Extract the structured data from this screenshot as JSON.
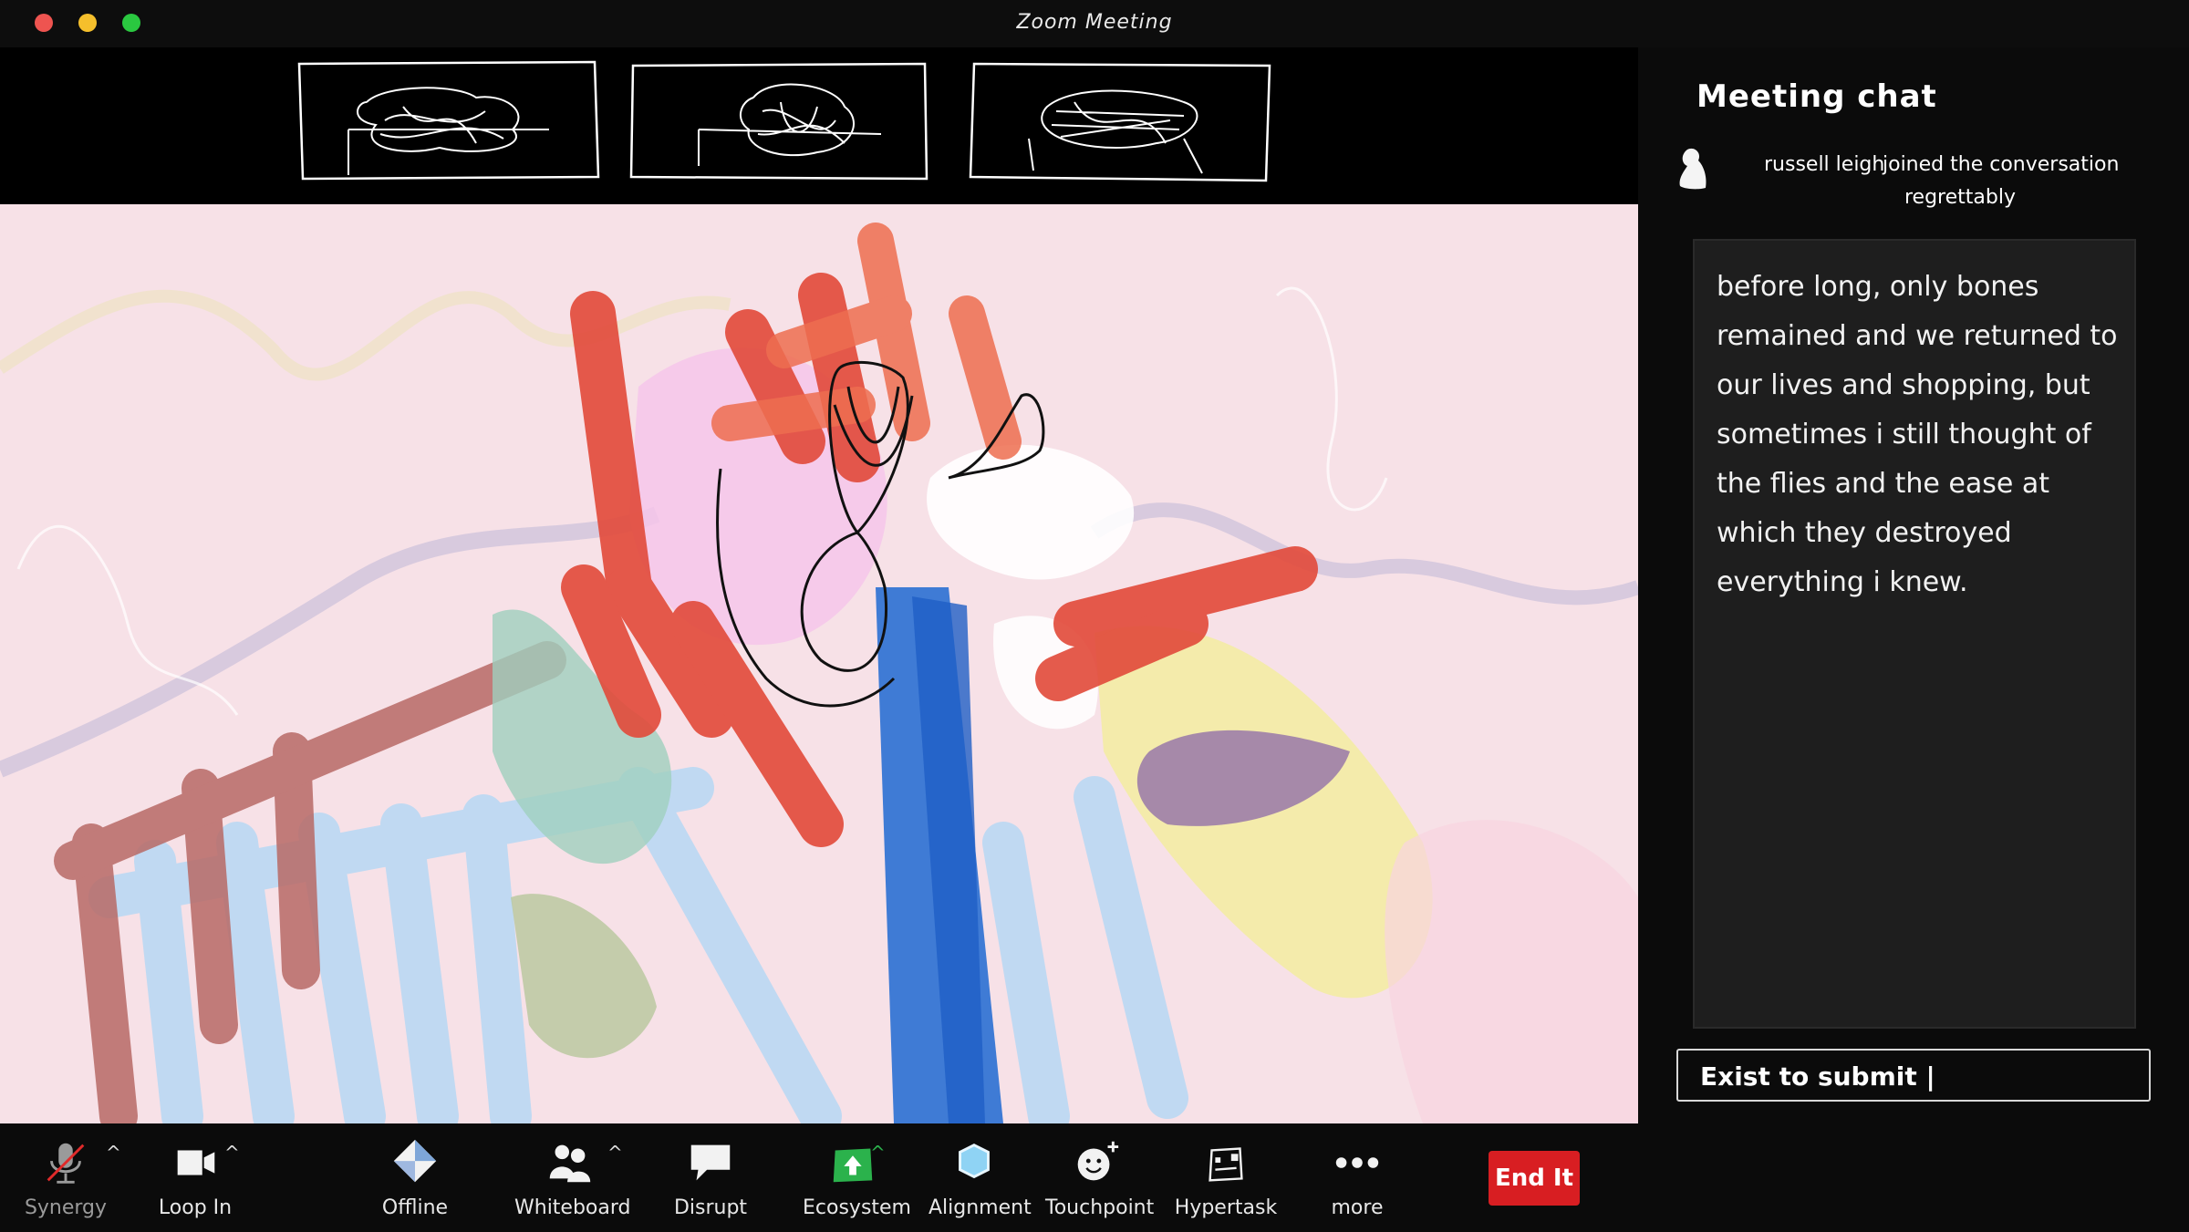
{
  "window": {
    "title": "Zoom Meeting"
  },
  "chat": {
    "title": "Meeting chat",
    "join_user": "russell leigh",
    "join_message": "joined the conversation",
    "join_message_2": "regrettably",
    "message": "before long, only bones remained and we returned to our lives and shopping, but sometimes i still thought of the flies and the ease at which they destroyed everything i knew.",
    "input_value": "Exist to submit |"
  },
  "toolbar": {
    "synergy": "Synergy",
    "loop_in": "Loop In",
    "offline": "Offline",
    "whiteboard": "Whiteboard",
    "disrupt": "Disrupt",
    "ecosystem": "Ecosystem",
    "alignment": "Alignment",
    "touchpoint": "Touchpoint",
    "hypertask": "Hypertask",
    "more": "more",
    "end": "End It"
  },
  "colors": {
    "end_button": "#d81e22",
    "ecosystem_icon": "#2bb24c",
    "alignment_icon": "#8fd3f4",
    "video_bg": "#f8e0e6"
  },
  "icons": {
    "synergy": "muted-microphone-icon",
    "loop_in": "video-camera-icon",
    "offline": "diamond-icon",
    "whiteboard": "people-icon",
    "disrupt": "speech-bubble-icon",
    "ecosystem": "upload-arrow-icon",
    "alignment": "hexagon-icon",
    "touchpoint": "smiley-plus-icon",
    "hypertask": "task-sheet-icon",
    "more": "ellipsis-icon"
  }
}
